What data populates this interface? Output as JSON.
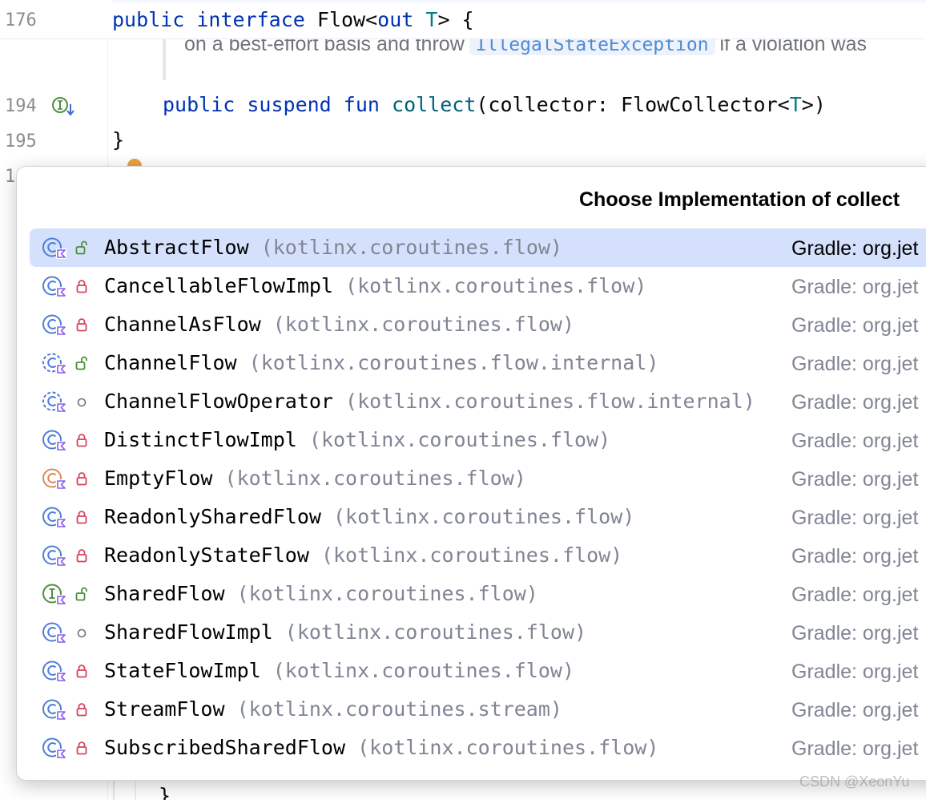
{
  "editor": {
    "sticky": {
      "line_number": "176",
      "kw_public": "public",
      "kw_interface": "interface",
      "name": "Flow<",
      "kw_out": "out",
      "type_param": "T",
      "rest": "> {"
    },
    "doc": {
      "before": "on a best-effort basis and throw",
      "code": "IllegalStateException",
      "after": "if a violation was"
    },
    "line194": {
      "line_number": "194",
      "kw_public": "public",
      "kw_suspend": "suspend",
      "kw_fun": "fun",
      "fn_name": "collect",
      "params_a": "(collector: FlowCollector<",
      "type_param": "T",
      "params_b": ">)"
    },
    "line195": {
      "line_number": "195",
      "text": "}"
    },
    "line196": {
      "line_number": "1"
    },
    "bottom_brace": "}"
  },
  "popup": {
    "title": "Choose Implementation of collect",
    "items": [
      {
        "name": "AbstractFlow",
        "pkg": "(kotlinx.coroutines.flow)",
        "source": "Gradle: org.jet",
        "icon": "class-icon",
        "vis": "open-lock-icon",
        "selected": true
      },
      {
        "name": "CancellableFlowImpl",
        "pkg": "(kotlinx.coroutines.flow)",
        "source": "Gradle: org.jet",
        "icon": "class-icon",
        "vis": "lock-icon"
      },
      {
        "name": "ChannelAsFlow",
        "pkg": "(kotlinx.coroutines.flow)",
        "source": "Gradle: org.jet",
        "icon": "class-icon",
        "vis": "lock-icon"
      },
      {
        "name": "ChannelFlow",
        "pkg": "(kotlinx.coroutines.flow.internal)",
        "source": "Gradle: org.jet",
        "icon": "abstract-class-icon",
        "vis": "open-lock-icon"
      },
      {
        "name": "ChannelFlowOperator",
        "pkg": "(kotlinx.coroutines.flow.internal)",
        "source": "Gradle: org.jet",
        "icon": "abstract-class-icon",
        "vis": "circle-icon"
      },
      {
        "name": "DistinctFlowImpl",
        "pkg": "(kotlinx.coroutines.flow)",
        "source": "Gradle: org.jet",
        "icon": "class-icon",
        "vis": "lock-icon"
      },
      {
        "name": "EmptyFlow",
        "pkg": "(kotlinx.coroutines.flow)",
        "source": "Gradle: org.jet",
        "icon": "object-icon",
        "vis": "lock-icon"
      },
      {
        "name": "ReadonlySharedFlow",
        "pkg": "(kotlinx.coroutines.flow)",
        "source": "Gradle: org.jet",
        "icon": "class-icon",
        "vis": "lock-icon"
      },
      {
        "name": "ReadonlyStateFlow",
        "pkg": "(kotlinx.coroutines.flow)",
        "source": "Gradle: org.jet",
        "icon": "class-icon",
        "vis": "lock-icon"
      },
      {
        "name": "SharedFlow",
        "pkg": "(kotlinx.coroutines.flow)",
        "source": "Gradle: org.jet",
        "icon": "interface-icon",
        "vis": "open-lock-icon"
      },
      {
        "name": "SharedFlowImpl",
        "pkg": "(kotlinx.coroutines.flow)",
        "source": "Gradle: org.jet",
        "icon": "class-icon",
        "vis": "circle-icon"
      },
      {
        "name": "StateFlowImpl",
        "pkg": "(kotlinx.coroutines.flow)",
        "source": "Gradle: org.jet",
        "icon": "class-icon",
        "vis": "lock-icon"
      },
      {
        "name": "StreamFlow",
        "pkg": "(kotlinx.coroutines.stream)",
        "source": "Gradle: org.jet",
        "icon": "class-icon",
        "vis": "lock-icon"
      },
      {
        "name": "SubscribedSharedFlow",
        "pkg": "(kotlinx.coroutines.flow)",
        "source": "Gradle: org.jet",
        "icon": "class-icon",
        "vis": "lock-icon"
      }
    ]
  },
  "watermark": "CSDN @XeonYu",
  "colors": {
    "selection": "#d5e1fc",
    "keyword": "#0033b3",
    "function": "#00627a",
    "lock": "#d6455d",
    "open_lock": "#4d8f3a",
    "class_icon": "#4f7dd9",
    "object_icon": "#e08856",
    "interface_icon": "#4d8f3a",
    "kotlin_badge": "#8c5fe8"
  }
}
